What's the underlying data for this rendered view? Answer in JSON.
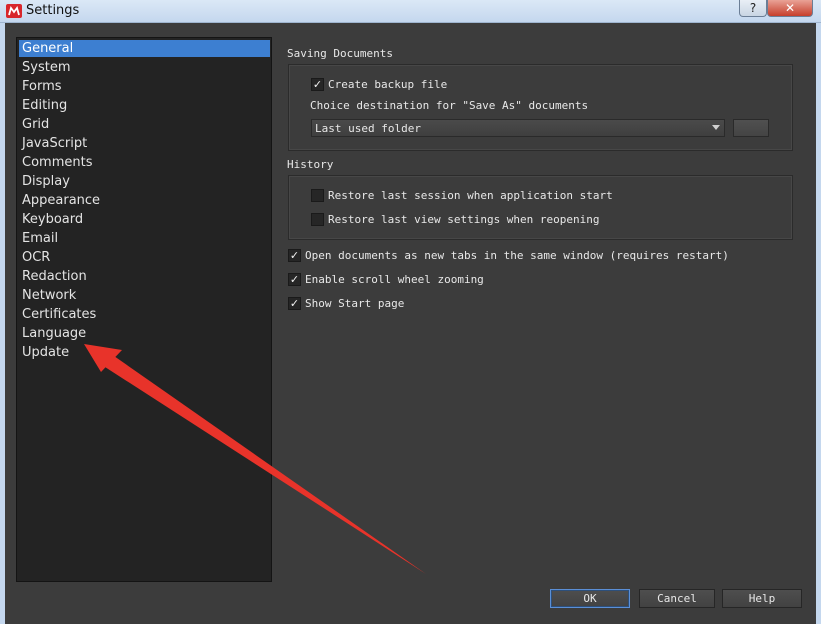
{
  "window": {
    "title": "Settings",
    "app_icon": "app-logo-icon",
    "help_glyph": "?",
    "close_glyph": "✕"
  },
  "categories": [
    {
      "label": "General",
      "selected": true
    },
    {
      "label": "System"
    },
    {
      "label": "Forms"
    },
    {
      "label": "Editing"
    },
    {
      "label": "Grid"
    },
    {
      "label": "JavaScript"
    },
    {
      "label": "Comments"
    },
    {
      "label": "Display"
    },
    {
      "label": "Appearance"
    },
    {
      "label": "Keyboard"
    },
    {
      "label": "Email"
    },
    {
      "label": "OCR"
    },
    {
      "label": "Redaction"
    },
    {
      "label": "Network"
    },
    {
      "label": "Certificates"
    },
    {
      "label": "Language"
    },
    {
      "label": "Update"
    }
  ],
  "saving": {
    "title": "Saving Documents",
    "create_backup_label": "Create backup file",
    "create_backup_checked": true,
    "destination_label": "Choice destination for \"Save As\" documents",
    "destination_value": "Last used folder"
  },
  "history": {
    "title": "History",
    "restore_session_label": "Restore last session when application start",
    "restore_session_checked": false,
    "restore_view_label": "Restore last view settings when reopening",
    "restore_view_checked": false
  },
  "options": {
    "new_tabs_label": "Open documents as new tabs in the same window (requires restart)",
    "new_tabs_checked": true,
    "scroll_zoom_label": "Enable scroll wheel zooming",
    "scroll_zoom_checked": true,
    "start_page_label": "Show Start page",
    "start_page_checked": true
  },
  "check_glyph": "✓",
  "buttons": {
    "ok": "OK",
    "cancel": "Cancel",
    "help": "Help"
  },
  "colors": {
    "accent_selected": "#3d7fd1",
    "annotation_arrow": "#e8332a"
  }
}
